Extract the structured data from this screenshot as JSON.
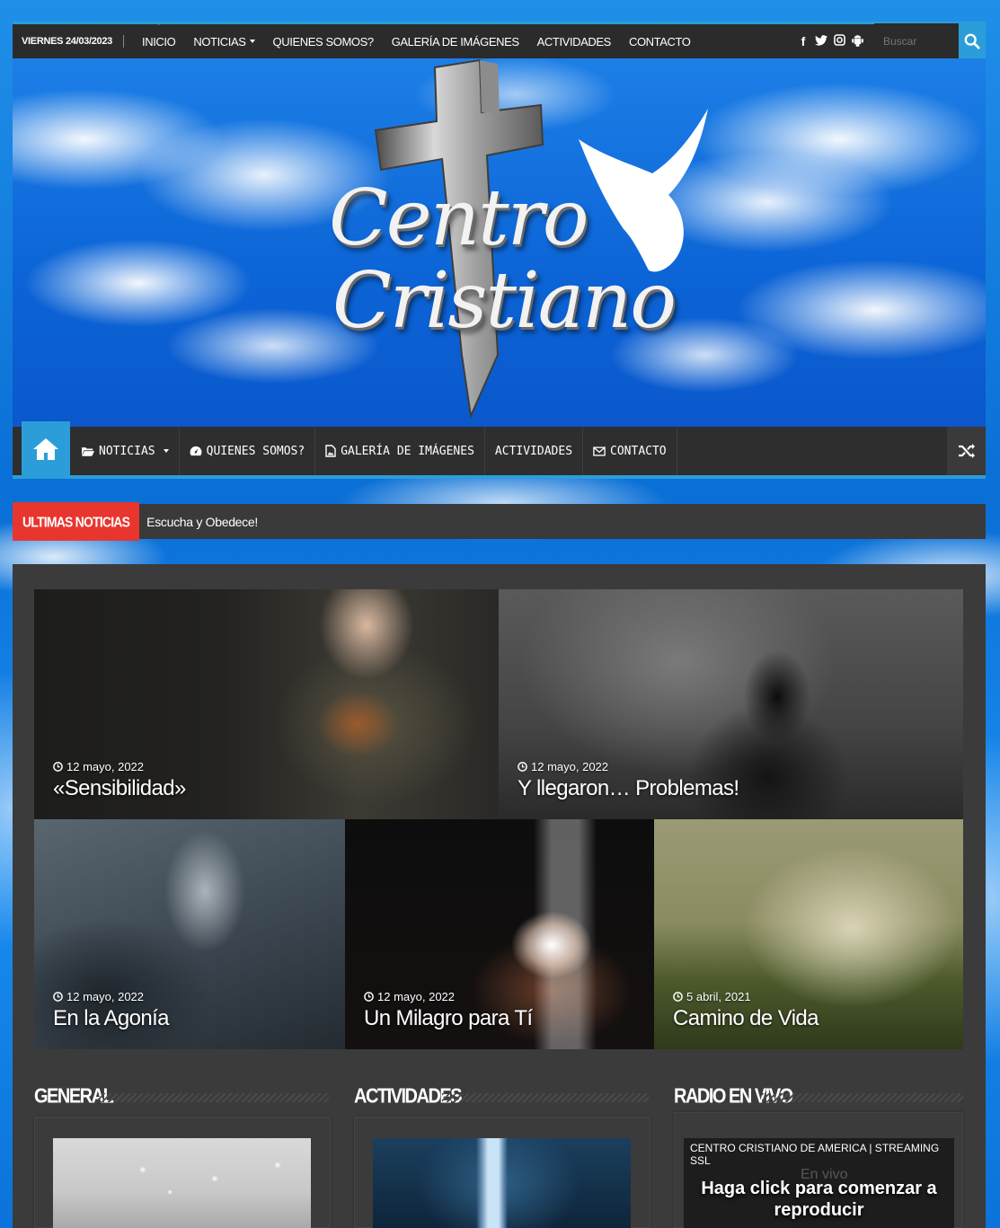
{
  "topbar": {
    "date": "VIERNES 24/03/2023",
    "nav": [
      {
        "label": "INICIO"
      },
      {
        "label": "NOTICIAS"
      },
      {
        "label": "QUIENES SOMOS?"
      },
      {
        "label": "GALERÍA DE IMÁGENES"
      },
      {
        "label": "ACTIVIDADES"
      },
      {
        "label": "CONTACTO"
      }
    ],
    "social": [
      "facebook-icon",
      "twitter-icon",
      "instagram-icon",
      "android-icon"
    ],
    "search_placeholder": "Buscar"
  },
  "logo": {
    "line1": "Centro",
    "line2": "Cristiano"
  },
  "mainnav": {
    "items": [
      {
        "label": "NOTICIAS",
        "icon": "folder-open-icon"
      },
      {
        "label": "QUIENES SOMOS?",
        "icon": "dashboard-icon"
      },
      {
        "label": "GALERÍA DE IMÁGENES",
        "icon": "file-image-icon"
      },
      {
        "label": "ACTIVIDADES"
      },
      {
        "label": "CONTACTO",
        "icon": "envelope-icon"
      }
    ]
  },
  "breaking": {
    "label": "ULTIMAS NOTICIAS",
    "headline": "Escucha y Obedece!"
  },
  "featured": [
    {
      "date": "12 mayo, 2022",
      "title": "«Sensibilidad»"
    },
    {
      "date": "12 mayo, 2022",
      "title": "Y llegaron… Problemas!"
    },
    {
      "date": "12 mayo, 2022",
      "title": "En la Agonía"
    },
    {
      "date": "12 mayo, 2022",
      "title": "Un Milagro para Tí"
    },
    {
      "date": "5 abril, 2021",
      "title": "Camino de Vida"
    }
  ],
  "sections": {
    "general": "GENERAL",
    "actividades": "ACTIVIDADES",
    "radio": "RADIO EN VIVO"
  },
  "radio": {
    "header": "CENTRO CRISTIANO DE AMERICA | STREAMING SSL",
    "cta_line1": "Haga click para comenzar a",
    "cta_line2": "reproducir",
    "ghost": "En vivo"
  },
  "colors": {
    "accent": "#2b9ed9",
    "breaking": "#e8352e",
    "dark": "#2b2b2b"
  }
}
